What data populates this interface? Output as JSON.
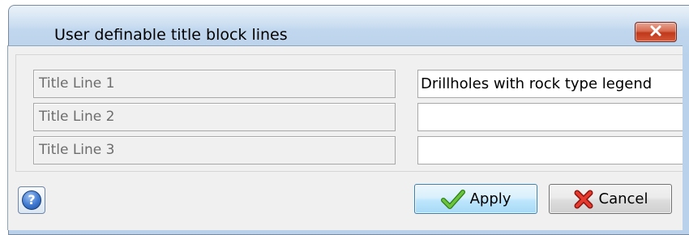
{
  "window": {
    "title": "User definable title block lines"
  },
  "rows": [
    {
      "label": "Title Line 1",
      "value": "Drillholes with rock type legend"
    },
    {
      "label": "Title Line 2",
      "value": ""
    },
    {
      "label": "Title Line 3",
      "value": ""
    }
  ],
  "buttons": {
    "help_symbol": "?",
    "apply_label": "Apply",
    "cancel_label": "Cancel"
  },
  "icons": {
    "close": "close-icon",
    "help": "help-icon",
    "apply": "checkmark-icon",
    "cancel": "x-icon"
  },
  "colors": {
    "titlebar": "#c1d7ee",
    "close_button": "#c0391b",
    "apply_button": "#bee6fd",
    "check_green": "#4caf2a",
    "cancel_red": "#d8261e"
  }
}
